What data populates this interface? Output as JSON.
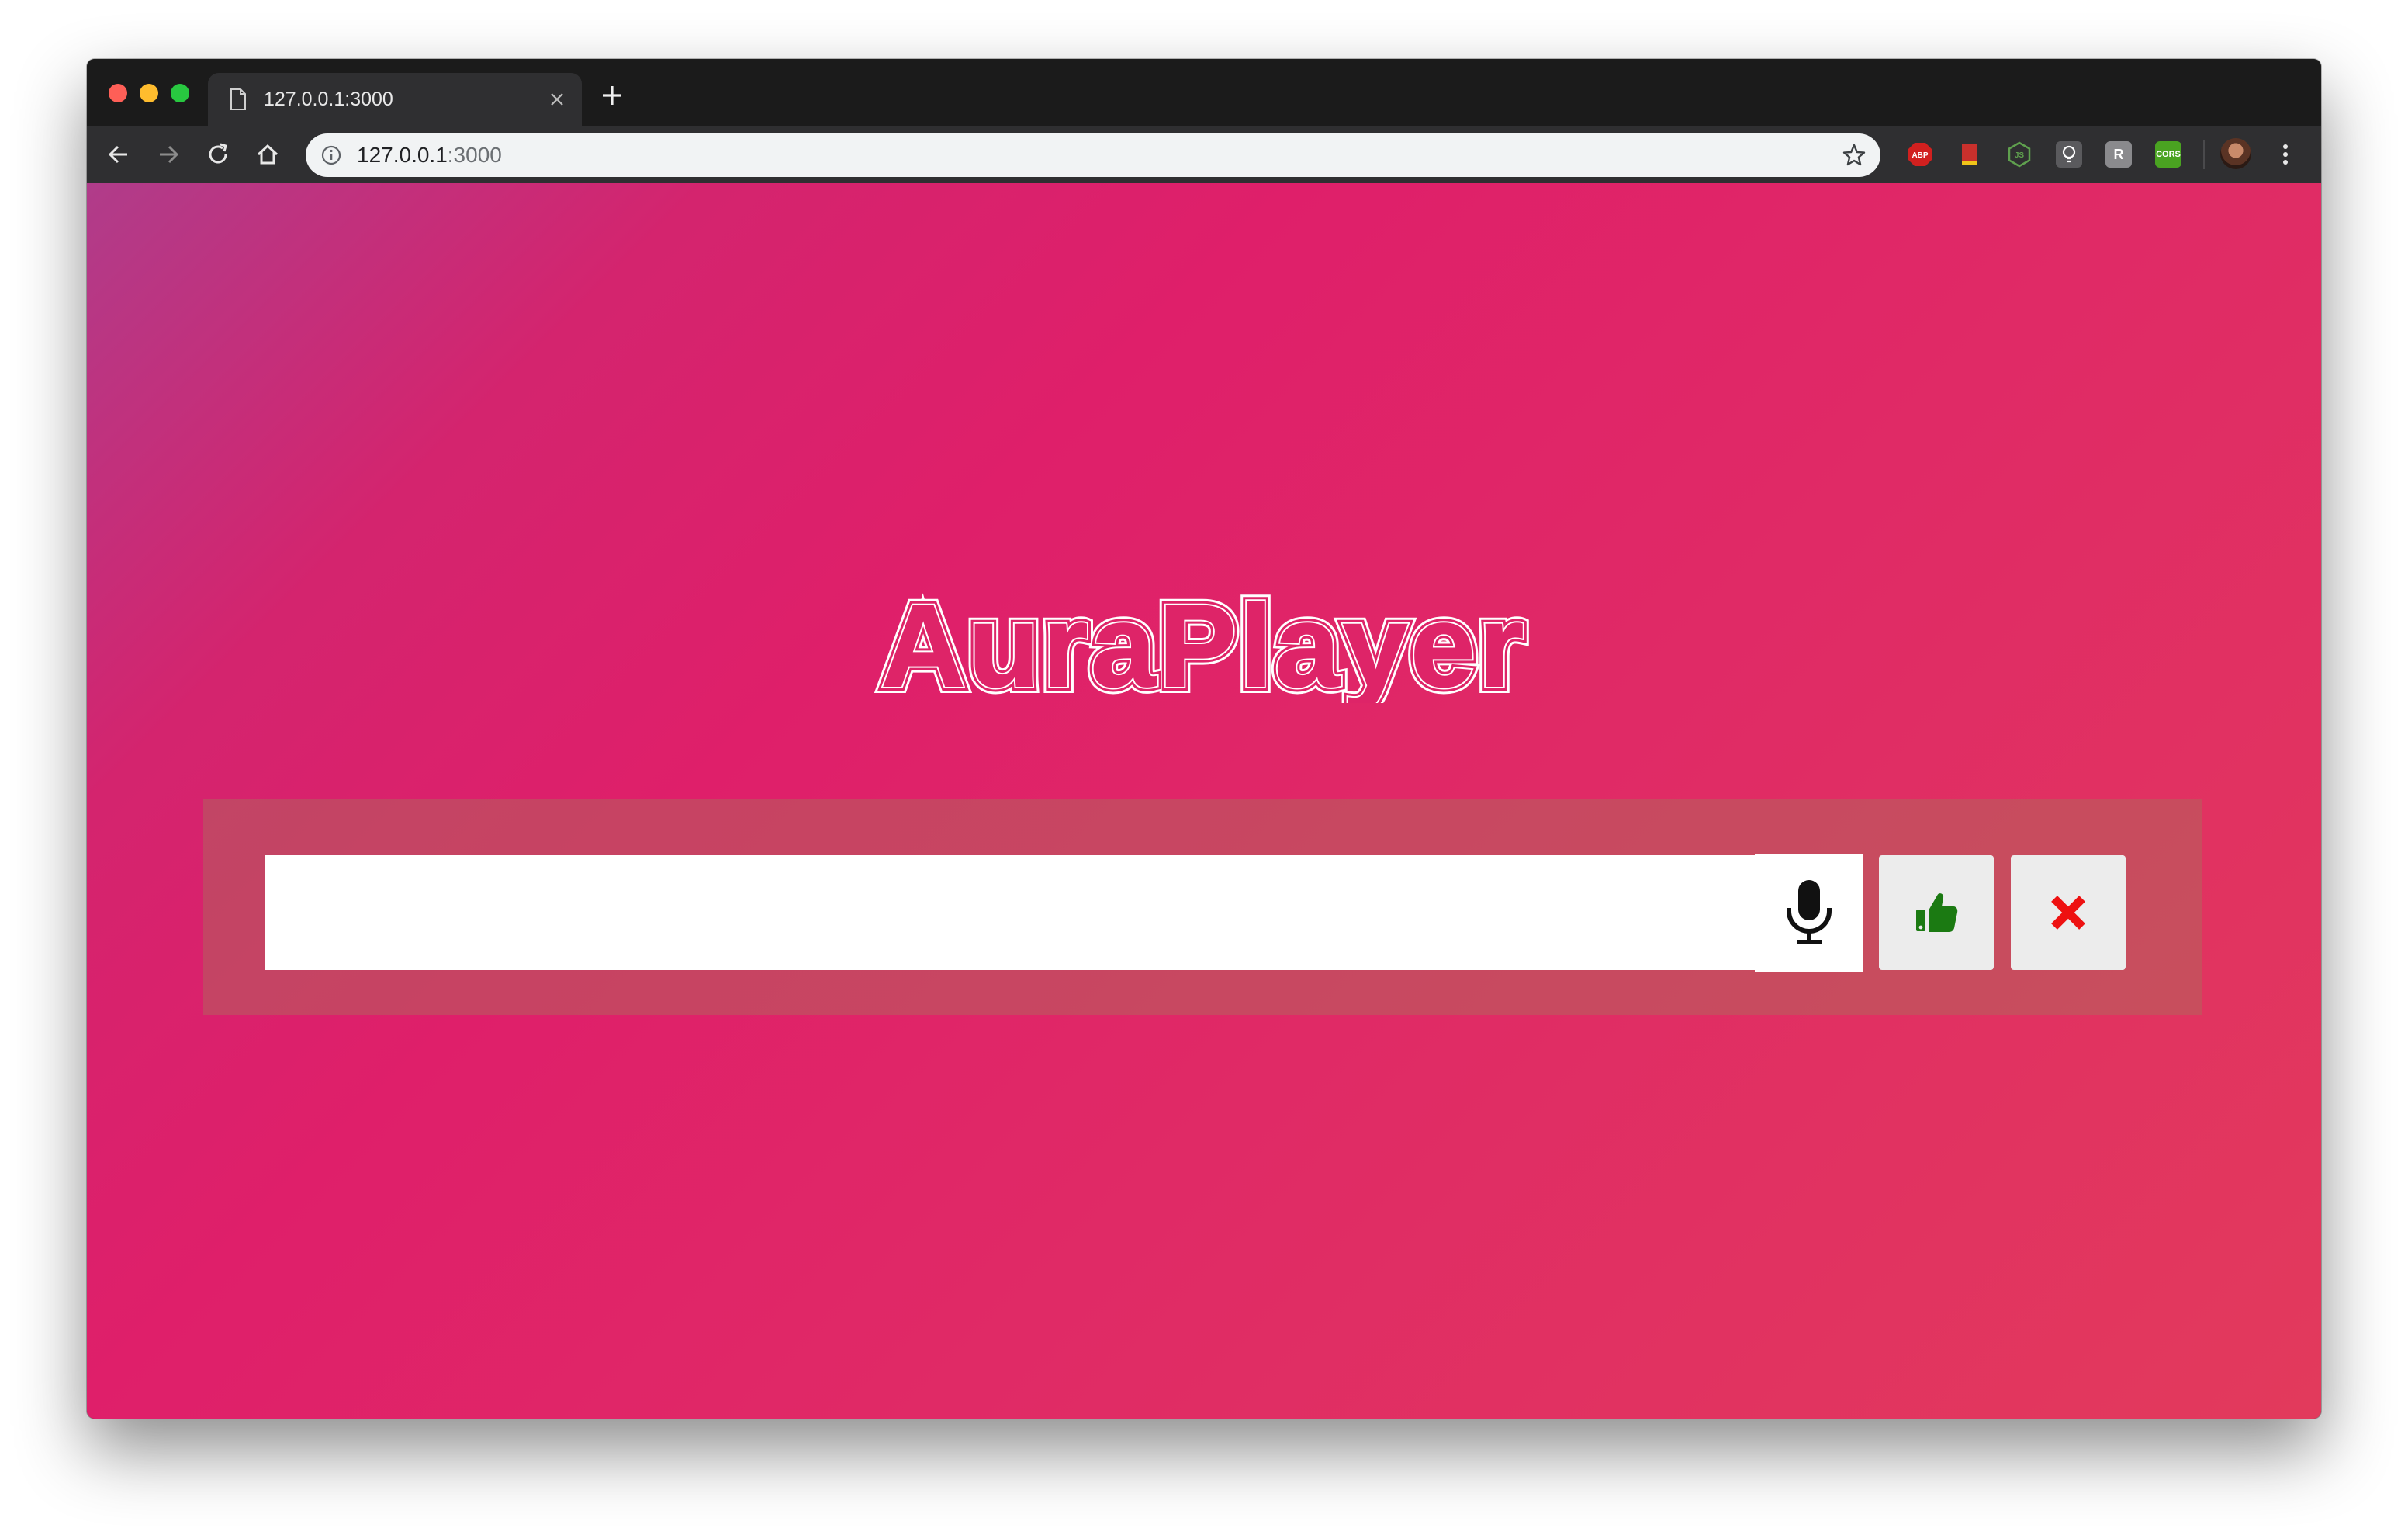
{
  "browser": {
    "tab_title": "127.0.0.1:3000",
    "url_host": "127.0.0.1",
    "url_port": ":3000",
    "extensions": [
      {
        "name": "adblock-plus-icon",
        "label": "ABP",
        "color": "#d1201f"
      },
      {
        "name": "bookmark-red-icon",
        "label": "",
        "color": "#c9302c"
      },
      {
        "name": "nodejs-icon",
        "label": "JS",
        "color": "#3c8a2e"
      },
      {
        "name": "lightbulb-icon",
        "label": "",
        "color": "#6d6d70"
      },
      {
        "name": "lambda-icon",
        "label": "R",
        "color": "#8a8a8d"
      },
      {
        "name": "cors-icon",
        "label": "CORS",
        "color": "#4aa321"
      }
    ]
  },
  "app": {
    "logo_text": "AuraPlayer",
    "search": {
      "value": "",
      "placeholder": ""
    },
    "colors": {
      "like_icon": "#1b7a12",
      "dismiss_icon": "#ee1111",
      "mic_icon": "#111111"
    }
  }
}
